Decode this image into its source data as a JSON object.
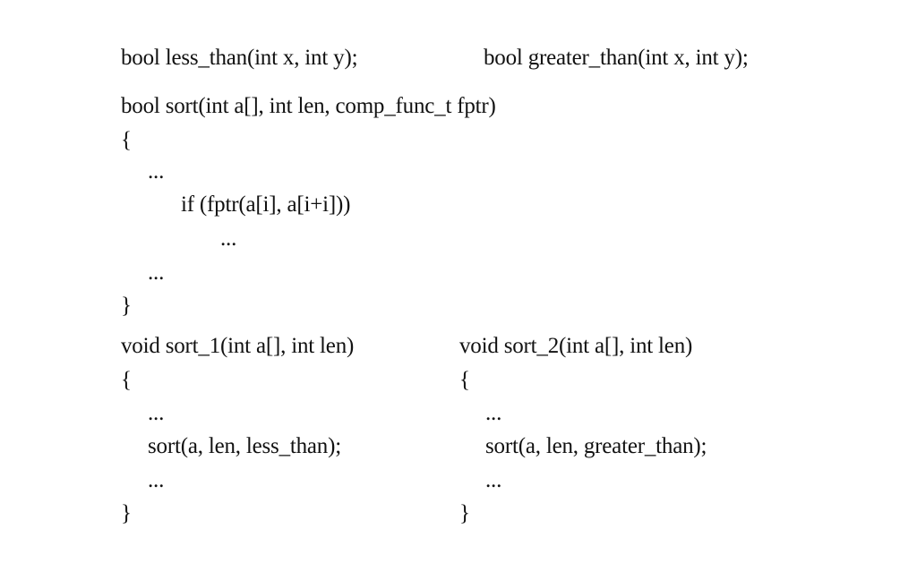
{
  "code": {
    "decl_less_than": "bool less_than(int x, int y);",
    "decl_greater_than": "bool greater_than(int x, int y);",
    "sort_signature": "bool sort(int a[], int len, comp_func_t fptr)",
    "sort_open_brace": "{",
    "sort_ellipsis_1": "...",
    "sort_if_line": "if (fptr(a[i], a[i+i]))",
    "sort_ellipsis_inner": "...",
    "sort_ellipsis_2": "...",
    "sort_close_brace": "}",
    "sort1": {
      "signature": "void sort_1(int a[], int len)",
      "open_brace": "{",
      "ellipsis_1": "...",
      "call": "sort(a, len, less_than);",
      "ellipsis_2": "...",
      "close_brace": "}"
    },
    "sort2": {
      "signature": "void sort_2(int a[], int len)",
      "open_brace": "{",
      "ellipsis_1": "...",
      "call": "sort(a, len, greater_than);",
      "ellipsis_2": "...",
      "close_brace": "}"
    }
  }
}
